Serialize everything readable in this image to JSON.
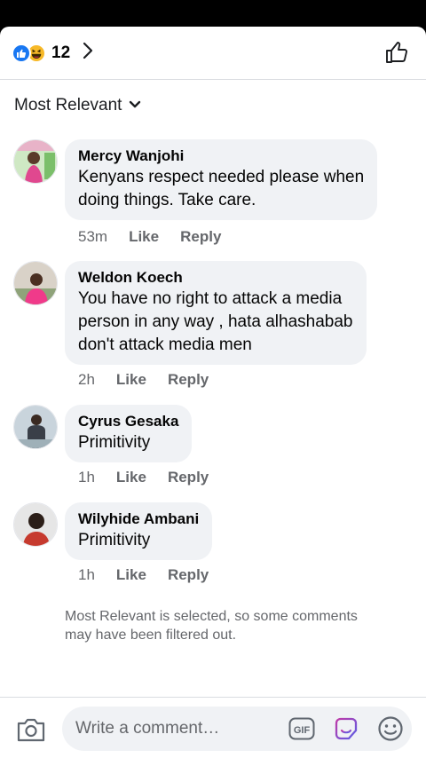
{
  "header": {
    "reaction_count": "12",
    "reaction_icons": [
      "like-icon",
      "haha-icon"
    ]
  },
  "sort": {
    "label": "Most Relevant"
  },
  "comments": [
    {
      "name": "Mercy Wanjohi",
      "lines": [
        "Kenyans  respect needed please when",
        "doing things. Take care."
      ],
      "time": "53m",
      "like": "Like",
      "reply": "Reply"
    },
    {
      "name": "Weldon Koech",
      "lines": [
        "You have no right to attack a media",
        "person in any way , hata alhashabab",
        "don't attack media men"
      ],
      "time": "2h",
      "like": "Like",
      "reply": "Reply"
    },
    {
      "name": "Cyrus Gesaka",
      "lines": [
        "Primitivity"
      ],
      "time": "1h",
      "like": "Like",
      "reply": "Reply"
    },
    {
      "name": "Wilyhide Ambani",
      "lines": [
        "Primitivity"
      ],
      "time": "1h",
      "like": "Like",
      "reply": "Reply"
    }
  ],
  "notice": "Most Relevant is selected, so some comments may have been filtered out.",
  "composer": {
    "placeholder": "Write a comment…",
    "icons": [
      "camera-icon",
      "gif-icon",
      "sticker-icon",
      "emoji-icon"
    ]
  },
  "colors": {
    "bubble": "#f0f2f5",
    "meta": "#65676b",
    "like_blue": "#1877f2",
    "haha_yellow": "#f7b928"
  }
}
